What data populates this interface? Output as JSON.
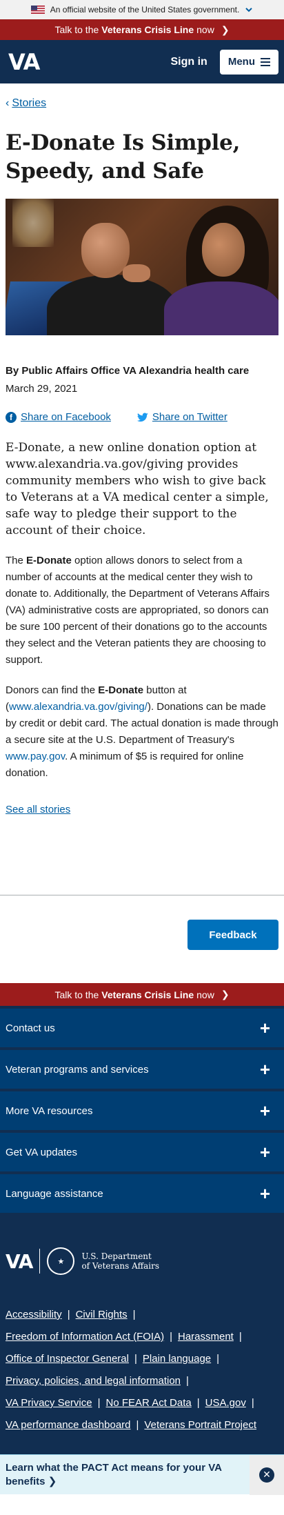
{
  "gov_banner": {
    "text": "An official website of the United States government."
  },
  "crisis": {
    "prefix": "Talk to the",
    "bold": "Veterans Crisis Line",
    "suffix": "now"
  },
  "header": {
    "logo": "VA",
    "signin": "Sign in",
    "menu": "Menu"
  },
  "breadcrumb": {
    "label": "Stories"
  },
  "article": {
    "title": "E-Donate Is Simple, Speedy, and Safe",
    "byline": "By Public Affairs Office VA Alexandria health care",
    "date": "March 29, 2021",
    "share_facebook": "Share on Facebook",
    "share_twitter": "Share on Twitter",
    "lead": "E-Donate, a new online donation option at www.alexandria.va.gov/giving provides community members who wish to give back to Veterans at a VA medical center a simple, safe way to pledge their support to the account of their choice.",
    "p1_a": "The ",
    "p1_bold": "E-Donate",
    "p1_b": " option allows donors to select from a number of accounts at the medical center they wish to donate to. Additionally, the Department of Veterans Affairs (VA) administrative costs are appropriated, so donors can be sure 100 percent of their donations go to the accounts they select and the Veteran patients they are choosing to support.",
    "p2_a": "Donors can find the ",
    "p2_bold": "E-Donate",
    "p2_b": " button at (",
    "p2_link1": "www.alexandria.va.gov/giving/",
    "p2_c": "). Donations can be made by credit or debit card. The actual donation is made through a secure site at the U.S. Department of Treasury's ",
    "p2_link2": "www.pay.gov",
    "p2_d": ". A minimum of $5 is required for online donation.",
    "see_all": "See all stories"
  },
  "feedback": {
    "label": "Feedback"
  },
  "footer": {
    "accordion": [
      "Contact us",
      "Veteran programs and services",
      "More VA resources",
      "Get VA updates",
      "Language assistance"
    ],
    "logo": "VA",
    "dept_line1": "U.S. Department",
    "dept_line2": "of Veterans Affairs",
    "links": {
      "accessibility": "Accessibility",
      "civil_rights": "Civil Rights",
      "foia": "Freedom of Information Act (FOIA)",
      "harassment": "Harassment",
      "oig": "Office of Inspector General",
      "plain_language": "Plain language",
      "privacy": "Privacy, policies, and legal information",
      "privacy_service": "VA Privacy Service",
      "no_fear": "No FEAR Act Data",
      "usa_gov": "USA.gov",
      "performance": "VA performance dashboard",
      "portrait": "Veterans Portrait Project"
    }
  },
  "pact": {
    "text": "Learn what the PACT Act means for your VA benefits"
  },
  "colors": {
    "navy": "#112e51",
    "crisis_red": "#9c1c1c",
    "link_blue": "#005ea2",
    "feedback_blue": "#0071bb"
  }
}
